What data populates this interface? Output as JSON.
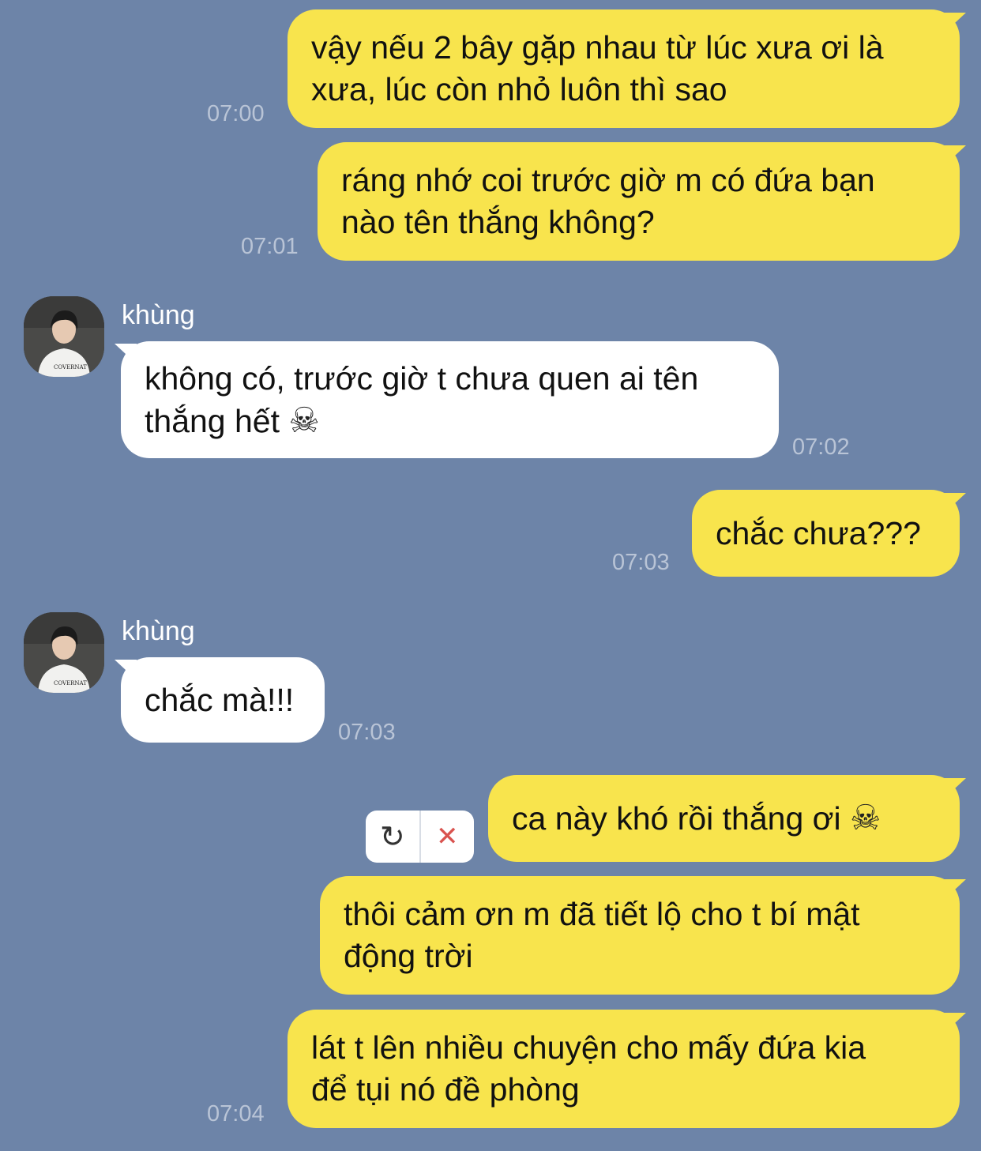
{
  "contact": {
    "name": "khùng"
  },
  "messages": [
    {
      "from": "me",
      "text": "vậy nếu 2 bây gặp nhau từ lúc xưa ơi là\nxưa, lúc còn nhỏ luôn thì sao",
      "time": "07:00"
    },
    {
      "from": "me",
      "text": "ráng nhớ coi trước giờ m có đứa bạn\nnào tên thắng không?",
      "time": "07:01"
    },
    {
      "from": "them",
      "sender": "khùng",
      "text": "không có, trước giờ t chưa quen ai tên\nthắng hết",
      "emoji": "☠",
      "time": "07:02"
    },
    {
      "from": "me",
      "text": "chắc chưa???",
      "time": "07:03"
    },
    {
      "from": "them",
      "sender": "khùng",
      "text": "chắc mà!!!",
      "time": "07:03"
    },
    {
      "from": "me",
      "text": "ca này khó rồi thắng ơi",
      "emoji": "☠",
      "status": "failed"
    },
    {
      "from": "me",
      "text": "thôi cảm ơn m đã tiết lộ cho t bí mật\nđộng trời"
    },
    {
      "from": "me",
      "text": "lát t lên nhiều chuyện cho mấy đứa kia\nđể tụi nó đề phòng",
      "time": "07:04"
    }
  ],
  "failed_actions": {
    "retry_icon": "retry-icon",
    "retry_glyph": "↻",
    "delete_icon": "close-icon",
    "delete_glyph": "✕"
  },
  "colors": {
    "background": "#6d84a8",
    "my_bubble": "#f8e44d",
    "their_bubble": "#ffffff",
    "timestamp": "#b9c4d6",
    "delete": "#d9534f"
  }
}
